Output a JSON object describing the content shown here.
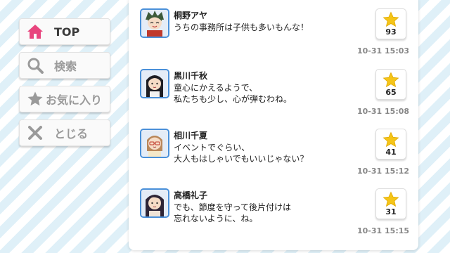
{
  "nav": {
    "items": [
      {
        "label": "TOP",
        "icon": "home-icon",
        "active": true
      },
      {
        "label": "検索",
        "icon": "search-icon"
      },
      {
        "label": "お気に入り",
        "icon": "star-icon"
      },
      {
        "label": "とじる",
        "icon": "close-icon"
      }
    ]
  },
  "feed": [
    {
      "name": "桐野アヤ",
      "lines": [
        "うちの事務所は子供も多いもんな！"
      ],
      "likes": "93",
      "time": "10-31 15:03"
    },
    {
      "name": "黒川千秋",
      "lines": [
        "童心にかえるようで、",
        "私たちも少し、心が弾むわね。"
      ],
      "likes": "65",
      "time": "10-31 15:08"
    },
    {
      "name": "相川千夏",
      "lines": [
        "イベントでぐらい、",
        "大人もはしゃいでもいいじゃない？"
      ],
      "likes": "41",
      "time": "10-31 15:12"
    },
    {
      "name": "高橋礼子",
      "lines": [
        "でも、節度を守って後片付けは",
        "忘れないように、ね。"
      ],
      "likes": "31",
      "time": "10-31 15:15"
    }
  ],
  "colors": {
    "home_accent": "#e8457e",
    "nav_icon_gray": "#9a9a9a",
    "star": "#f5c518",
    "avatar_border": "#4a90d9",
    "time_gray": "#888888"
  }
}
